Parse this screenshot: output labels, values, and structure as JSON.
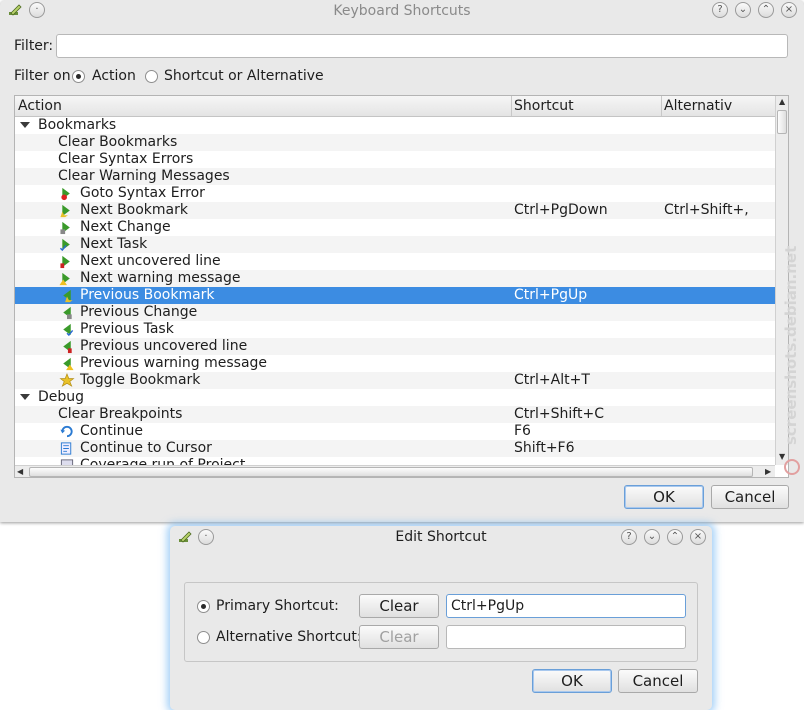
{
  "main_window": {
    "title": "Keyboard Shortcuts",
    "filter_label": "Filter:",
    "filter_value": "",
    "filter_on_label": "Filter on",
    "filter_options": [
      {
        "label": "Action",
        "checked": true
      },
      {
        "label": "Shortcut or Alternative",
        "checked": false
      }
    ],
    "columns": [
      "Action",
      "Shortcut",
      "Alternativ"
    ],
    "rows": [
      {
        "level": 0,
        "label": "Bookmarks",
        "shortcut": "",
        "alternative": "",
        "icon": ""
      },
      {
        "level": 1,
        "label": "Clear Bookmarks",
        "shortcut": "",
        "alternative": "",
        "icon": ""
      },
      {
        "level": 1,
        "label": "Clear Syntax Errors",
        "shortcut": "",
        "alternative": "",
        "icon": ""
      },
      {
        "level": 1,
        "label": "Clear Warning Messages",
        "shortcut": "",
        "alternative": "",
        "icon": ""
      },
      {
        "level": 1,
        "label": "Goto Syntax Error",
        "shortcut": "",
        "alternative": "",
        "icon": "goto-error-icon"
      },
      {
        "level": 1,
        "label": "Next Bookmark",
        "shortcut": "Ctrl+PgDown",
        "alternative": "Ctrl+Shift+,",
        "icon": "next-bookmark-icon"
      },
      {
        "level": 1,
        "label": "Next Change",
        "shortcut": "",
        "alternative": "",
        "icon": "next-change-icon"
      },
      {
        "level": 1,
        "label": "Next Task",
        "shortcut": "",
        "alternative": "",
        "icon": "next-task-icon"
      },
      {
        "level": 1,
        "label": "Next uncovered line",
        "shortcut": "",
        "alternative": "",
        "icon": "next-uncovered-icon"
      },
      {
        "level": 1,
        "label": "Next warning message",
        "shortcut": "",
        "alternative": "",
        "icon": "next-warning-icon"
      },
      {
        "level": 1,
        "label": "Previous Bookmark",
        "shortcut": "Ctrl+PgUp",
        "alternative": "",
        "icon": "previous-bookmark-icon",
        "selected": true
      },
      {
        "level": 1,
        "label": "Previous Change",
        "shortcut": "",
        "alternative": "",
        "icon": "previous-change-icon"
      },
      {
        "level": 1,
        "label": "Previous Task",
        "shortcut": "",
        "alternative": "",
        "icon": "previous-task-icon"
      },
      {
        "level": 1,
        "label": "Previous uncovered line",
        "shortcut": "",
        "alternative": "",
        "icon": "previous-uncovered-icon"
      },
      {
        "level": 1,
        "label": "Previous warning message",
        "shortcut": "",
        "alternative": "",
        "icon": "previous-warning-icon"
      },
      {
        "level": 1,
        "label": "Toggle Bookmark",
        "shortcut": "Ctrl+Alt+T",
        "alternative": "",
        "icon": "toggle-bookmark-icon"
      },
      {
        "level": 0,
        "label": "Debug",
        "shortcut": "",
        "alternative": "",
        "icon": ""
      },
      {
        "level": 1,
        "label": "Clear Breakpoints",
        "shortcut": "Ctrl+Shift+C",
        "alternative": "",
        "icon": ""
      },
      {
        "level": 1,
        "label": "Continue",
        "shortcut": "F6",
        "alternative": "",
        "icon": "continue-icon"
      },
      {
        "level": 1,
        "label": "Continue to Cursor",
        "shortcut": "Shift+F6",
        "alternative": "",
        "icon": "continue-to-cursor-icon"
      },
      {
        "level": 1,
        "label": "Coverage run of Project",
        "shortcut": "",
        "alternative": "",
        "icon": "coverage-icon"
      }
    ],
    "ok_label": "OK",
    "cancel_label": "Cancel",
    "watermark": "screenshots.debian.net"
  },
  "edit_dialog": {
    "title": "Edit Shortcut",
    "primary_label": "Primary Shortcut:",
    "primary_checked": true,
    "primary_clear": "Clear",
    "primary_value": "Ctrl+PgUp",
    "alternative_label": "Alternative Shortcut:",
    "alternative_checked": false,
    "alternative_clear": "Clear",
    "alternative_value": "",
    "ok_label": "OK",
    "cancel_label": "Cancel"
  },
  "colors": {
    "selection": "#3c8ce2",
    "window_bg": "#e9e9e9",
    "dialog_glow": "#5aaaf0"
  }
}
